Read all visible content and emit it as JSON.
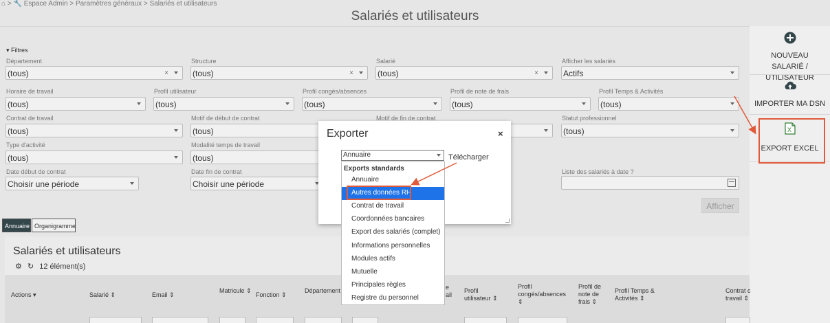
{
  "breadcrumb": {
    "home_icon": "home-icon",
    "sep": ">",
    "wrench_icon": "wrench-icon",
    "text": "Espace Admin > Paramètres généraux > Salariés et utilisateurs"
  },
  "page": {
    "title": "Salariés et utilisateurs"
  },
  "sidebar": {
    "new_user": {
      "icon": "plus-circle-icon",
      "label": "NOUVEAU SALARIÉ / UTILISATEUR"
    },
    "import_dsn": {
      "icon": "cloud-upload-icon",
      "label": "IMPORTER MA DSN"
    },
    "export_excel": {
      "icon": "excel-icon",
      "label": "EXPORT EXCEL"
    }
  },
  "filters": {
    "toggle": "▾ Filtres",
    "departement": {
      "label": "Département",
      "value": "(tous)"
    },
    "structure": {
      "label": "Structure",
      "value": "(tous)"
    },
    "salarie": {
      "label": "Salarié",
      "value": "(tous)"
    },
    "afficher_salaries": {
      "label": "Afficher les salariés",
      "value": "Actifs"
    },
    "horaire": {
      "label": "Horaire de travail",
      "value": "(tous)"
    },
    "profil_utilisateur": {
      "label": "Profil utilisateur",
      "value": "(tous)"
    },
    "profil_conges": {
      "label": "Profil congés/absences",
      "value": "(tous)"
    },
    "profil_frais": {
      "label": "Profil de note de frais",
      "value": "(tous)"
    },
    "profil_temps": {
      "label": "Profil Temps & Activités",
      "value": "(tous)"
    },
    "contrat": {
      "label": "Contrat de travail",
      "value": "(tous)"
    },
    "motif_debut": {
      "label": "Motif de début de contrat",
      "value": "(tous)"
    },
    "motif_fin": {
      "label": "Motif de fin de contrat",
      "value": ""
    },
    "statut": {
      "label": "Statut professionnel",
      "value": "(tous)"
    },
    "type_activite": {
      "label": "Type d'activité",
      "value": "(tous)"
    },
    "modalite": {
      "label": "Modalité temps de travail",
      "value": "(tous)"
    },
    "date_debut": {
      "label": "Date début de contrat",
      "value": "Choisir une période"
    },
    "date_fin": {
      "label": "Date fin de contrat",
      "value": "Choisir une période"
    },
    "liste_date": {
      "label": "Liste des salariés à date",
      "help_icon": "question-circle-icon",
      "value": ""
    },
    "afficher_button": "Afficher"
  },
  "tabs": [
    {
      "label": "Annuaire",
      "active": true
    },
    {
      "label": "Organigramme",
      "active": false
    }
  ],
  "list": {
    "title": "Salariés et utilisateurs",
    "count": "12 élément(s)",
    "columns": {
      "actions": "Actions ▾",
      "salarie": "Salarié ⇕",
      "email": "Email ⇕",
      "matricule": "Matricule ⇕",
      "fonction": "Fonction ⇕",
      "departement": "Département",
      "hidden1": "e",
      "hidden2": "ail",
      "profil_utilisateur_1": "Profil",
      "profil_utilisateur_2": "utilisateur ⇕",
      "profil_conges_1": "Profil",
      "profil_conges_2": "congés/absences",
      "profil_conges_3": "⇕",
      "profil_frais_1": "Profil de",
      "profil_frais_2": "note de",
      "profil_frais_3": "frais ⇕",
      "profil_temps_1": "Profil Temps &",
      "profil_temps_2": "Activités ⇕",
      "contrat_1": "Contrat c",
      "contrat_2": "travail ⇕"
    }
  },
  "modal": {
    "title": "Exporter",
    "close": "×",
    "select_value": "Annuaire",
    "download_link": "Télécharger",
    "group": "Exports standards",
    "options": [
      "Annuaire",
      "Autres données RH",
      "Contrat de travail",
      "Coordonnées bancaires",
      "Export des salariés (complet)",
      "Informations personnelles",
      "Modules actifs",
      "Mutuelle",
      "Principales règles",
      "Registre du personnel"
    ],
    "selected_index": 1
  },
  "colors": {
    "accent_dark": "#33464a",
    "highlight": "#1e73e8",
    "annotation": "#e05a3a",
    "excel_green": "#2e7d32"
  }
}
